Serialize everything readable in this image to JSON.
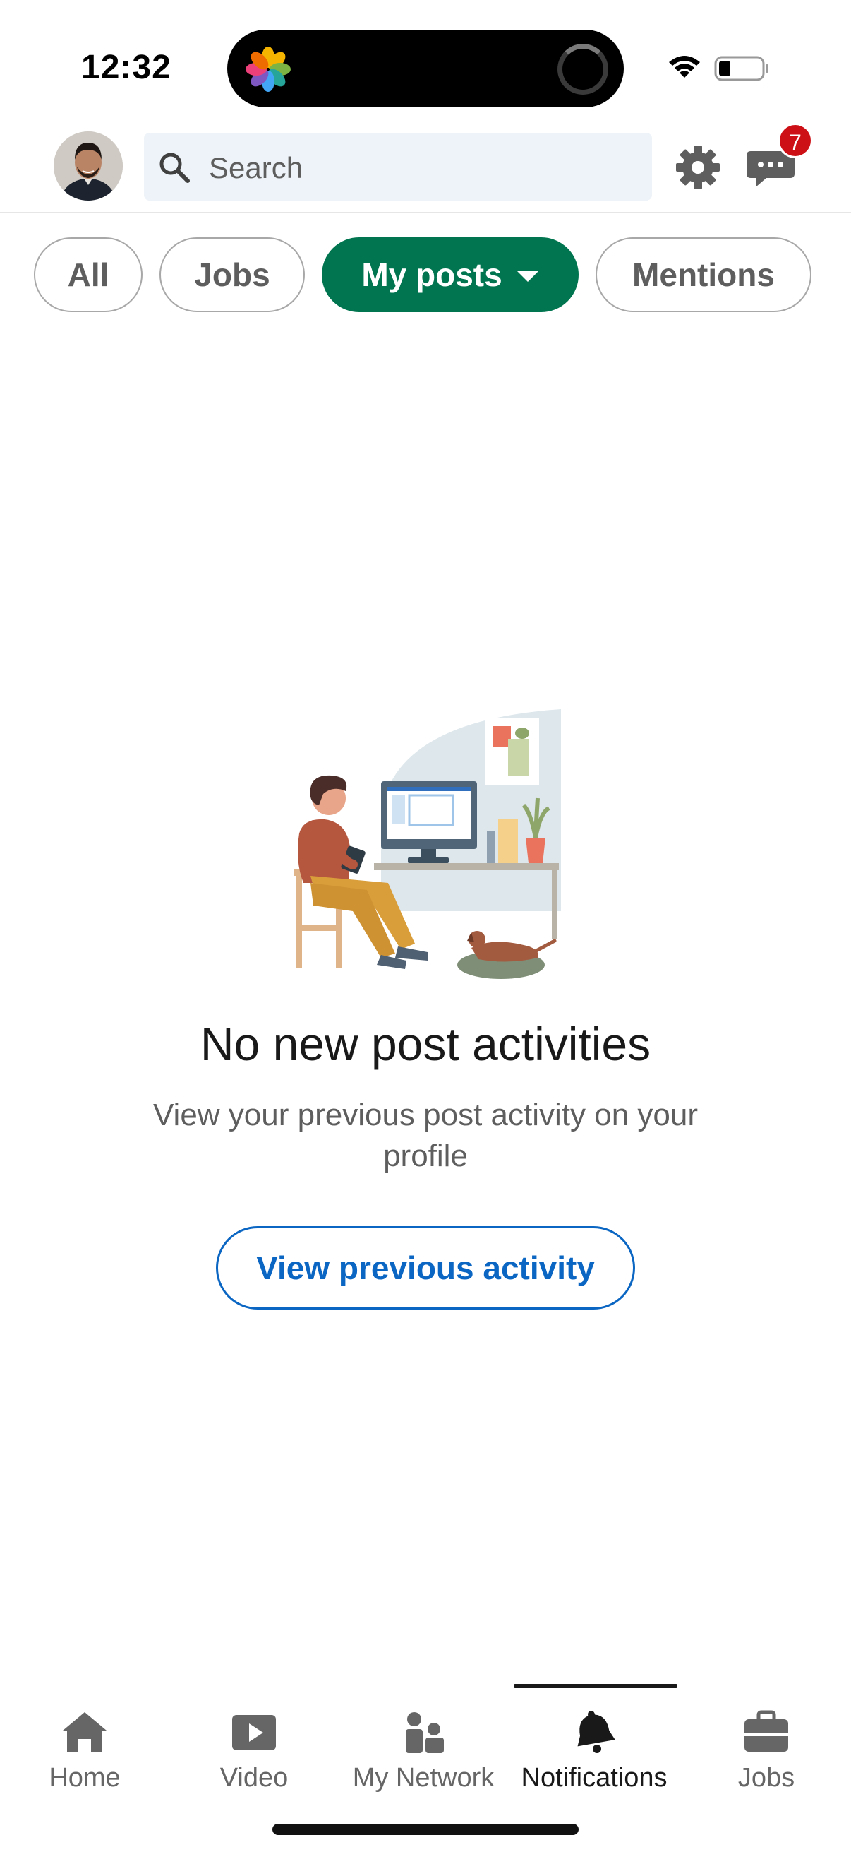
{
  "status_bar": {
    "time": "12:32"
  },
  "header": {
    "search_placeholder": "Search",
    "messages_badge": "7",
    "icons": [
      "avatar",
      "search-icon",
      "gear-icon",
      "messages-icon"
    ]
  },
  "filters": [
    {
      "label": "All",
      "active": false
    },
    {
      "label": "Jobs",
      "active": false
    },
    {
      "label": "My posts",
      "active": true
    },
    {
      "label": "Mentions",
      "active": false
    }
  ],
  "empty_state": {
    "title": "No new post activities",
    "subtitle": "View your previous post activity on your profile",
    "button_label": "View previous activity"
  },
  "bottom_nav": [
    {
      "label": "Home",
      "icon": "home-icon"
    },
    {
      "label": "Video",
      "icon": "video-icon"
    },
    {
      "label": "My Network",
      "icon": "network-icon"
    },
    {
      "label": "Notifications",
      "icon": "bell-icon",
      "active": true
    },
    {
      "label": "Jobs",
      "icon": "briefcase-icon"
    }
  ],
  "colors": {
    "accent_green": "#01754f",
    "link_blue": "#0a66c2",
    "badge_red": "#cc1016",
    "search_bg": "#edf3f8"
  }
}
